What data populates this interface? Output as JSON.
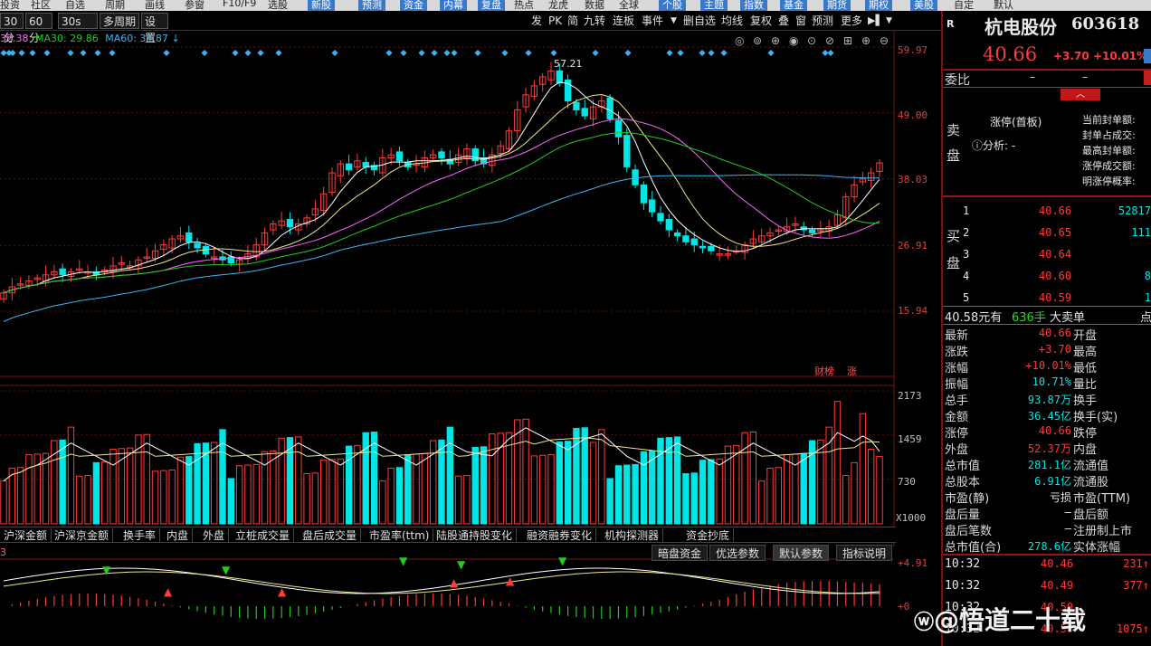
{
  "top_menu": {
    "items": [
      "投资",
      "社区",
      "自选",
      "周期",
      "画线",
      "参窗",
      "F10/F9",
      "选股",
      "新股",
      "预测",
      "资金",
      "内幕",
      "复盘",
      "热点",
      "龙虎",
      "数据",
      "全球",
      "个股",
      "主题",
      "指数",
      "基金",
      "期货",
      "期权",
      "美股",
      "自定",
      "默认"
    ]
  },
  "toolbar": {
    "left": [
      "30分",
      "60分",
      "30s",
      "多周期",
      "设置"
    ],
    "right": [
      "发",
      "PK",
      "简",
      "九转",
      "连板",
      "事件",
      "删自选",
      "均线",
      "复权",
      "叠",
      "窗",
      "预测",
      "更多"
    ]
  },
  "ma_legend": {
    "ma20": "32.38",
    "ma30_label": "MA30: 29.86",
    "ma60_label": "MA60: 34.87"
  },
  "price_axis": [
    "59.97",
    "49.00",
    "38.03",
    "26.91",
    "15.94"
  ],
  "peak_label": "57.21",
  "badges": [
    "财榜",
    "涨"
  ],
  "volume_axis": [
    "2173",
    "1459",
    "730",
    "X1000"
  ],
  "indicator_tabs": [
    "沪深金额",
    "沪深京金额",
    "换手率",
    "内盘",
    "外盘",
    "立桩成交量",
    "盘后成交量",
    "市盈率(ttm)",
    "陆股通持股变化",
    "融资融券变化",
    "机构探测器",
    "资金抄底"
  ],
  "indicator_buttons": [
    "暗盘资金",
    "优选参数",
    "默认参数",
    "指标说明"
  ],
  "indicator_axis": [
    "+4.91",
    "+0"
  ],
  "indicator_label": "3",
  "stock": {
    "name": "杭电股份",
    "code": "603618",
    "price": "40.66",
    "change": "+3.70",
    "pct": "+10.01%"
  },
  "order_book": {
    "weibi_label": "委比",
    "weibi_val1": "–",
    "weibi_val2": "–",
    "sell_label": "卖盘",
    "limit_title": "涨停(首板)",
    "analysis": "分析: -",
    "limit_stats": [
      "当前封单额:",
      "封单占成交:",
      "最高封单额:",
      "涨停成交额:",
      "明涨停概率:"
    ],
    "buy_label": "买盘",
    "bids": [
      {
        "lvl": "1",
        "price": "40.66",
        "vol": "52817"
      },
      {
        "lvl": "2",
        "price": "40.65",
        "vol": "111"
      },
      {
        "lvl": "3",
        "price": "40.64",
        "vol": ""
      },
      {
        "lvl": "4",
        "price": "40.60",
        "vol": "8"
      },
      {
        "lvl": "5",
        "price": "40.59",
        "vol": "1"
      }
    ],
    "big_order": {
      "price": "40.58元有",
      "qty": "636手",
      "label": "大卖单",
      "tail": "点"
    }
  },
  "quote": [
    {
      "l": "最新",
      "v": "40.66",
      "c": "red",
      "r": "开盘"
    },
    {
      "l": "涨跌",
      "v": "+3.70",
      "c": "red",
      "r": "最高"
    },
    {
      "l": "涨幅",
      "v": "+10.01%",
      "c": "red",
      "r": "最低"
    },
    {
      "l": "振幅",
      "v": "10.71%",
      "c": "cyan",
      "r": "量比"
    },
    {
      "l": "总手",
      "v": "93.87万",
      "c": "cyan",
      "r": "换手"
    },
    {
      "l": "金额",
      "v": "36.45亿",
      "c": "cyan",
      "r": "换手(实)"
    },
    {
      "l": "涨停",
      "v": "40.66",
      "c": "red",
      "r": "跌停"
    },
    {
      "l": "外盘",
      "v": "52.37万",
      "c": "red",
      "r": "内盘"
    },
    {
      "l": "总市值",
      "v": "281.1亿",
      "c": "cyan",
      "r": "流通值"
    },
    {
      "l": "总股本",
      "v": "6.91亿",
      "c": "cyan",
      "r": "流通股"
    },
    {
      "l": "市盈(静)",
      "v": "亏损",
      "c": "white",
      "r": "市盈(TTM)"
    },
    {
      "l": "盘后量",
      "v": "–",
      "c": "white",
      "r": "盘后额"
    },
    {
      "l": "盘后笔数",
      "v": "–",
      "c": "white",
      "r": "注册制上市"
    },
    {
      "l": "总市值(合)",
      "v": "278.6亿",
      "c": "cyan",
      "r": "实体涨幅"
    }
  ],
  "ticks": [
    {
      "t": "10:32",
      "p": "40.46",
      "v": "231"
    },
    {
      "t": "10:32",
      "p": "40.49",
      "v": "377"
    },
    {
      "t": "10:32",
      "p": "40.50",
      "v": ""
    },
    {
      "t": "10:32",
      "p": "40.50",
      "v": "1075"
    }
  ],
  "watermark": "@悟道二十载",
  "colors": {
    "up": "#ff3b3b",
    "down": "#00e5e5",
    "ma5": "#ffffff",
    "ma10": "#f0e68c",
    "ma20": "#ff66ff",
    "ma30": "#22cc22",
    "ma60": "#3db4f2"
  },
  "chart_data": {
    "type": "candlestick",
    "ylim": [
      15.94,
      59.97
    ],
    "price_ticks": [
      59.97,
      49.0,
      38.03,
      26.91,
      15.94
    ],
    "peak": 57.21,
    "closes": [
      19,
      20,
      20.5,
      21,
      21.5,
      22,
      22.5,
      22,
      22.5,
      23,
      22.5,
      22,
      22.8,
      23.5,
      24,
      23.5,
      24.5,
      25,
      26,
      27,
      28,
      28.5,
      27.5,
      26.5,
      25.5,
      25,
      24.5,
      24,
      24.5,
      25.5,
      27,
      29,
      30.5,
      31,
      30,
      30.5,
      31.5,
      33,
      35.5,
      39,
      40.5,
      39.5,
      41,
      40,
      39.5,
      41.5,
      42,
      41,
      40,
      40.5,
      41.5,
      42,
      41.5,
      40.5,
      42,
      43,
      41,
      40.5,
      42,
      43.5,
      46,
      49.5,
      52,
      53.5,
      55,
      56,
      54,
      51,
      49.5,
      48.5,
      50,
      51,
      48,
      45,
      40,
      37,
      34,
      32.5,
      31,
      29.5,
      28.5,
      27.5,
      27,
      26.5,
      26,
      25.5,
      25.5,
      26,
      27,
      28,
      28.5,
      29,
      29.5,
      30,
      30.5,
      29.5,
      29,
      29.5,
      30,
      32,
      35,
      37,
      38,
      39,
      40.66
    ],
    "volume_ylim": [
      0,
      2173
    ],
    "volume_ticks": [
      2173,
      1459,
      730
    ]
  }
}
